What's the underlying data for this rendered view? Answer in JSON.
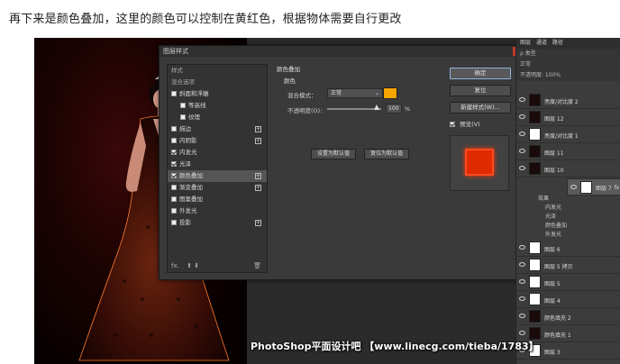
{
  "caption": "再下来是颜色叠加，这里的颜色可以控制在黄红色，根据物体需要自行更改",
  "dialog": {
    "title": "图层样式",
    "close": "×",
    "styles_header": "样式",
    "blend_options": "混合选项",
    "items": [
      {
        "label": "斜面和浮雕",
        "checked": false,
        "plus": false,
        "sub": false
      },
      {
        "label": "等高线",
        "checked": false,
        "plus": false,
        "sub": true
      },
      {
        "label": "纹理",
        "checked": false,
        "plus": false,
        "sub": true
      },
      {
        "label": "描边",
        "checked": false,
        "plus": true,
        "sub": false
      },
      {
        "label": "内阴影",
        "checked": false,
        "plus": true,
        "sub": false
      },
      {
        "label": "内发光",
        "checked": true,
        "plus": false,
        "sub": false
      },
      {
        "label": "光泽",
        "checked": true,
        "plus": false,
        "sub": false
      },
      {
        "label": "颜色叠加",
        "checked": true,
        "plus": true,
        "sub": false,
        "active": true
      },
      {
        "label": "渐变叠加",
        "checked": false,
        "plus": true,
        "sub": false
      },
      {
        "label": "图案叠加",
        "checked": false,
        "plus": false,
        "sub": false
      },
      {
        "label": "外发光",
        "checked": false,
        "plus": false,
        "sub": false
      },
      {
        "label": "投影",
        "checked": false,
        "plus": true,
        "sub": false
      }
    ],
    "footer_fx": "fx.",
    "footer_arrows": "⬆ ⬇",
    "footer_trash": "🗑",
    "panel": {
      "title": "颜色叠加",
      "subtitle": "颜色",
      "blend_label": "混合模式：",
      "blend_value": "正常",
      "overlay_color": "#f7a500",
      "opacity_label": "不透明度(O):",
      "opacity_value": "100",
      "opacity_unit": "%",
      "btn_default": "设置为默认值",
      "btn_reset": "复位为默认值"
    },
    "right": {
      "ok": "确定",
      "reset": "复位",
      "new_style": "新建样式(W)...",
      "preview_label": "预览(V)",
      "preview_checked": true,
      "preview_color": "#e02a00"
    }
  },
  "layers": {
    "tabs": [
      "图层",
      "通道",
      "路径"
    ],
    "filter": "ρ 类型",
    "mode": "正常",
    "opacity": "不透明度: 100%",
    "rows": [
      {
        "name": "亮度/对比度 2",
        "dark": true,
        "fx": false,
        "selected": false
      },
      {
        "name": "图层 12",
        "dark": true,
        "fx": false,
        "selected": false
      },
      {
        "name": "亮度/对比度 1",
        "dark": false,
        "fx": false,
        "selected": false
      },
      {
        "name": "图层 11",
        "dark": true,
        "fx": false,
        "selected": false
      },
      {
        "name": "图层 10",
        "dark": true,
        "fx": false,
        "selected": false
      },
      {
        "name": "图层 7",
        "dark": false,
        "fx": true,
        "selected": true
      }
    ],
    "effects_label": "效果",
    "effects": [
      "内发光",
      "光泽",
      "颜色叠加",
      "外发光"
    ],
    "rows_after": [
      {
        "name": "图层 6",
        "dark": false
      },
      {
        "name": "图层 5 拷贝",
        "dark": false
      },
      {
        "name": "图层 5",
        "dark": false
      },
      {
        "name": "图层 4",
        "dark": false
      },
      {
        "name": "颜色填充 2",
        "dark": true
      },
      {
        "name": "颜色填充 1",
        "dark": true
      },
      {
        "name": "图层 3",
        "dark": false
      }
    ],
    "fx_mark": "fx"
  },
  "watermark": "PhotoShop平面设计吧 【www.linecg.com/tieba/1783】"
}
